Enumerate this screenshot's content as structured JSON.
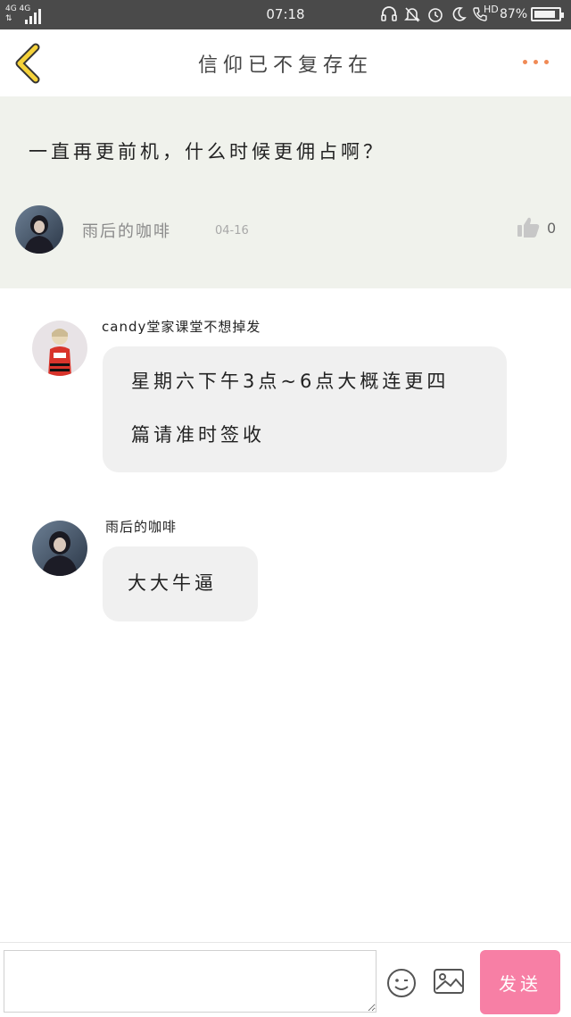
{
  "status_bar": {
    "network_top": "4G 4G",
    "network_bottom": "⇅",
    "time": "07:18",
    "hd_label": "HD",
    "battery_percent": "87%",
    "battery_level": 0.87
  },
  "nav": {
    "title": "信仰已不复存在"
  },
  "post": {
    "text": "一直再更前机，什么时候更佣占啊？",
    "author": "雨后的咖啡",
    "date": "04-16",
    "like_count": "0"
  },
  "replies": [
    {
      "name": "candy堂家课堂不想掉发",
      "lines": [
        "星期六下午3点~6点大概连更四",
        "篇请准时签收"
      ]
    },
    {
      "name": "雨后的咖啡",
      "lines": [
        "大大牛逼"
      ]
    }
  ],
  "input": {
    "value": "",
    "placeholder": "",
    "send_label": "发送"
  },
  "colors": {
    "accent_send": "#f77fa5",
    "back_arrow": "#f5d23a",
    "more_dots": "#f08a55",
    "post_bg": "#f0f2ec",
    "bubble_bg": "#f0f0f0"
  }
}
